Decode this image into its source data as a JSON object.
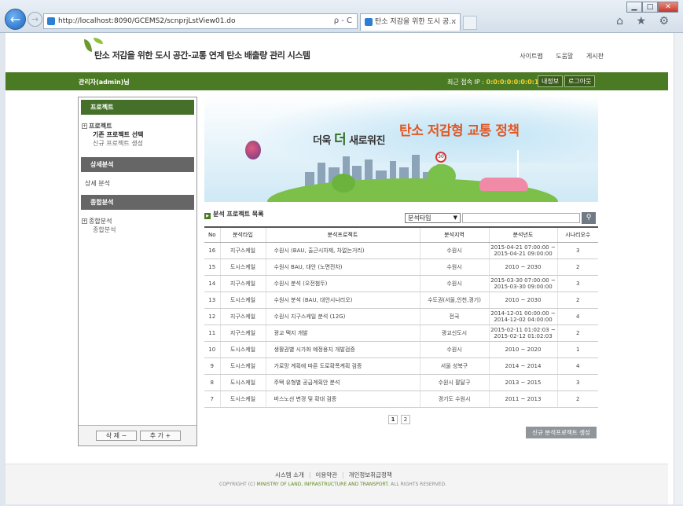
{
  "browser": {
    "url": "http://localhost:8090/GCEMS2/scnprjLstView01.do",
    "url_tools": "ρ - C",
    "tab_title": "탄소 저감을 위한 도시 공...",
    "tab_close": "×",
    "back": "←",
    "forward": "→",
    "win_min": "▁",
    "win_max": "□",
    "win_close": "✕",
    "toolbar_icons": "⌂ ★ ⚙"
  },
  "header": {
    "site_title": "탄소 저감을 위한 도시 공간-교통 연계 탄소 배출량 관리 시스템",
    "links": [
      "사이트맵",
      "도움말",
      "게시판"
    ]
  },
  "userbar": {
    "admin": "관리자(admin)님",
    "last_ip_label": "최근 접속 IP : ",
    "last_ip_value": "0:0:0:0:0:0:0:1",
    "info_button": "내정보",
    "logout_button": "로그아웃"
  },
  "sidebar": {
    "project_header": "프로젝트",
    "project_root": "프로젝트",
    "existing_project": "기존 프로젝트 선택",
    "new_project": "신규 프로젝트 생성",
    "detail_header": "상세분석",
    "detail_link": "상세 분석",
    "composite_header": "종합분석",
    "composite_root": "종합분석",
    "composite_child": "종합분석",
    "delete_button": "삭 제 −",
    "add_button": "추 가 +",
    "plus": "+"
  },
  "banner": {
    "slogan_prefix": "더욱",
    "slogan_big": "더",
    "slogan_suffix": "새로워진",
    "headline": "탄소 저감형 교통 정책",
    "speed_sign": "30"
  },
  "list": {
    "title": "분석 프로젝트 목록",
    "filter_value": "분석타입",
    "search_placeholder": "",
    "search_icon": "🔍",
    "columns": [
      "No",
      "분석타입",
      "분석프로젝트",
      "분석지역",
      "분석년도",
      "시나리오수"
    ],
    "rows": [
      {
        "no": "16",
        "type": "지구스케일",
        "name": "수원시 (BAU, 출근시차제, 차없는거리)",
        "region": "수원시",
        "period": "2015-04-21 07:00:00 ~ 2015-04-21 09:00:00",
        "scenarios": "3"
      },
      {
        "no": "15",
        "type": "도시스케일",
        "name": "수원시 BAU, 대안 (노면전차)",
        "region": "수원시",
        "period": "2010 ~ 2030",
        "scenarios": "2"
      },
      {
        "no": "14",
        "type": "지구스케일",
        "name": "수원시 분석 (오전첨두)",
        "region": "수원시",
        "period": "2015-03-30 07:00:00 ~ 2015-03-30 09:00:00",
        "scenarios": "3"
      },
      {
        "no": "13",
        "type": "도시스케일",
        "name": "수원시 분석 (BAU, 대안시나리오)",
        "region": "수도권(서울,인천,경기)",
        "period": "2010 ~ 2030",
        "scenarios": "2"
      },
      {
        "no": "12",
        "type": "지구스케일",
        "name": "수원시 지구스케일 분석 (12G)",
        "region": "전국",
        "period": "2014-12-01 00:00:00 ~ 2014-12-02 04:00:00",
        "scenarios": "4"
      },
      {
        "no": "11",
        "type": "지구스케일",
        "name": "광교 택지 개발",
        "region": "광교신도시",
        "period": "2015-02-11 01:02:03 ~ 2015-02-12 01:02:03",
        "scenarios": "2"
      },
      {
        "no": "10",
        "type": "도시스케일",
        "name": "생활권별 시가화 예정용지 개발검증",
        "region": "수원시",
        "period": "2010 ~ 2020",
        "scenarios": "1"
      },
      {
        "no": "9",
        "type": "도시스케일",
        "name": "가로망 계획에 따른 도로확폭계획 검증",
        "region": "서울 성북구",
        "period": "2014 ~ 2014",
        "scenarios": "4"
      },
      {
        "no": "8",
        "type": "도시스케일",
        "name": "주택 유형별 공급계획안 분석",
        "region": "수원시 팔달구",
        "period": "2013 ~ 2015",
        "scenarios": "3"
      },
      {
        "no": "7",
        "type": "도시스케일",
        "name": "버스노선 변경 및 확대 검증",
        "region": "경기도 수원시",
        "period": "2011 ~ 2013",
        "scenarios": "2"
      }
    ],
    "pages": [
      "1",
      "2"
    ],
    "new_project_button": "신규 분석프로젝트 생성"
  },
  "footer": {
    "links": [
      "시스템 소개",
      "이용약관",
      "개인정보취급정책"
    ],
    "copyright_prefix": "COPYRIGHT (C) ",
    "copyright_org": "MINISTRY OF LAND, INFRASTRUCTURE AND TRANSPORT.",
    "copyright_suffix": " ALL RIGHTS RESERVED."
  }
}
